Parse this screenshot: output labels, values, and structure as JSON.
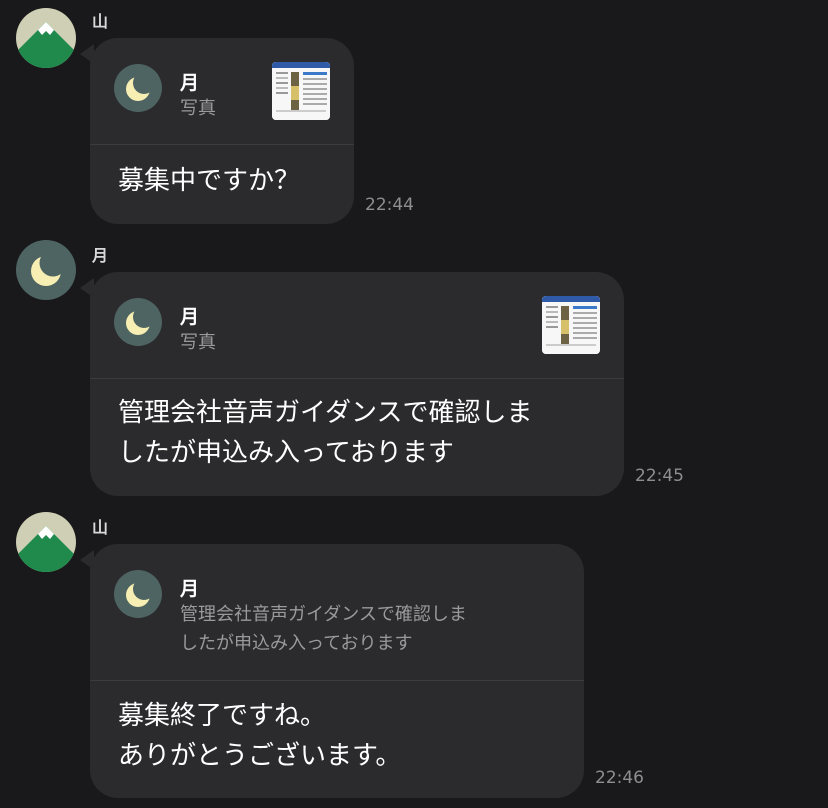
{
  "messages": [
    {
      "sender": "山",
      "reply_to": {
        "name": "月",
        "preview": "写真"
      },
      "text": "募集中ですか？",
      "time": "22:44"
    },
    {
      "sender": "月",
      "reply_to": {
        "name": "月",
        "preview": "写真"
      },
      "text": "管理会社音声ガイダンスで確認しま\nしたが申込み入っております",
      "time": "22:45"
    },
    {
      "sender": "山",
      "reply_to": {
        "name": "月",
        "preview": "管理会社音声ガイダンスで確認しま\nしたが申込み入っております"
      },
      "text": "募集終了ですね。\nありがとうございます。",
      "time": "22:46"
    }
  ],
  "icons": {
    "mountain": "mountain-avatar-icon",
    "moon": "moon-avatar-icon"
  },
  "colors": {
    "background": "#19191b",
    "bubble": "#2b2b2d",
    "mountain_green": "#1f8a4c",
    "moon_bg": "#4e6462",
    "moon": "#f6eeb3"
  }
}
